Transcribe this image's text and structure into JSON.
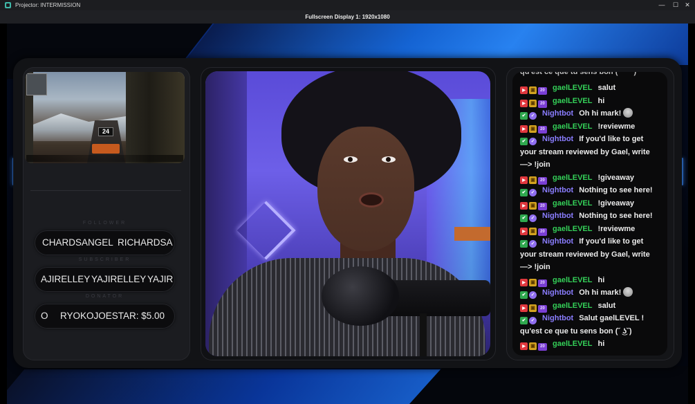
{
  "window": {
    "title": "Projector: INTERMISSION",
    "display_label": "Fullscreen Display 1: 1920x1080",
    "controls": {
      "minimize": "—",
      "maximize": "☐",
      "close": "✕"
    }
  },
  "widgets": {
    "ammo_count": "24",
    "follower": {
      "label": "FOLLOWER",
      "ticker_a": "CHARDSANGEL",
      "ticker_b": "RICHARDSA"
    },
    "subscriber": {
      "label": "SUBSCRIBER",
      "ticker_a": "AJIRELLEY",
      "ticker_b": "YAJIRELLEY",
      "ticker_c": "YAJIR"
    },
    "donator": {
      "label": "DONATOR",
      "ticker_a": "O",
      "ticker_b": "RYOKOJOESTAR: $5.00"
    }
  },
  "chat": {
    "partial_top": "qu'est ce que tu sens bon (¯︶¯)",
    "messages": [
      {
        "kind": "gael",
        "user": "gaelLEVEL",
        "text": "salut"
      },
      {
        "kind": "gael",
        "user": "gaelLEVEL",
        "text": "hi"
      },
      {
        "kind": "bot",
        "user": "Nightbot",
        "text": "Oh hi mark!"
      },
      {
        "kind": "gael",
        "user": "gaelLEVEL",
        "text": "!reviewme"
      },
      {
        "kind": "bot",
        "user": "Nightbot",
        "text": "If you'd like to get"
      },
      {
        "kind": "cont",
        "text": "your stream reviewed by Gael, write"
      },
      {
        "kind": "cont",
        "text": "—> !join"
      },
      {
        "kind": "gael",
        "user": "gaelLEVEL",
        "text": "!giveaway"
      },
      {
        "kind": "bot",
        "user": "Nightbot",
        "text": "Nothing to see here!"
      },
      {
        "kind": "gael",
        "user": "gaelLEVEL",
        "text": "!giveaway"
      },
      {
        "kind": "bot",
        "user": "Nightbot",
        "text": "Nothing to see here!"
      },
      {
        "kind": "gael",
        "user": "gaelLEVEL",
        "text": "!reviewme"
      },
      {
        "kind": "bot",
        "user": "Nightbot",
        "text": "If you'd like to get"
      },
      {
        "kind": "cont",
        "text": "your stream reviewed by Gael, write"
      },
      {
        "kind": "cont",
        "text": "—> !join"
      },
      {
        "kind": "gael",
        "user": "gaelLEVEL",
        "text": "hi"
      },
      {
        "kind": "bot",
        "user": "Nightbot",
        "text": "Oh hi mark!"
      },
      {
        "kind": "gael",
        "user": "gaelLEVEL",
        "text": "salut"
      },
      {
        "kind": "bot",
        "user": "Nightbot",
        "text": "Salut gaelLEVEL !"
      },
      {
        "kind": "cont",
        "text": "qu'est ce que tu sens bon (˘ ͜ʖ˘)"
      },
      {
        "kind": "gael",
        "user": "gaelLEVEL",
        "text": "hi"
      }
    ],
    "sub_badge": "20"
  }
}
